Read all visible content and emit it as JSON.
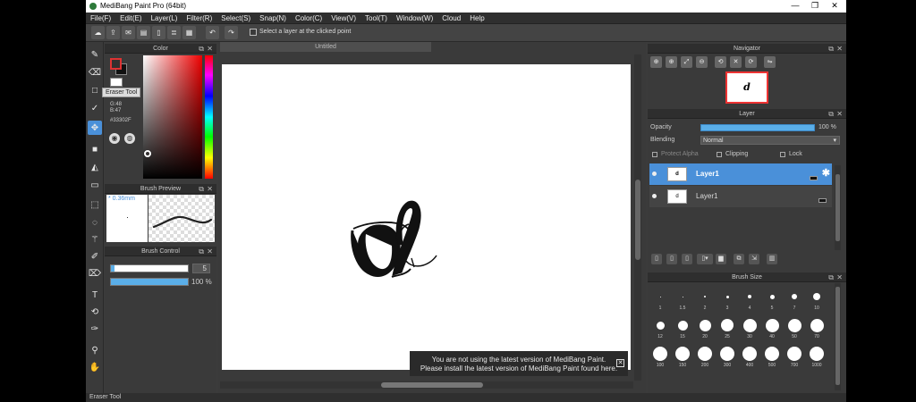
{
  "title": "MediBang Paint Pro (64bit)",
  "window_controls": [
    "—",
    "❐",
    "✕"
  ],
  "menu": [
    "File(F)",
    "Edit(E)",
    "Layer(L)",
    "Filter(R)",
    "Select(S)",
    "Snap(N)",
    "Color(C)",
    "View(V)",
    "Tool(T)",
    "Window(W)",
    "Cloud",
    "Help"
  ],
  "toolbar": {
    "icons": [
      "cloud-icon",
      "share-icon",
      "comment-icon",
      "message-icon",
      "document-icon",
      "list-icon",
      "grid-icon",
      "undo-icon",
      "redo-icon"
    ],
    "select_layer_label": "Select a layer at the clicked point"
  },
  "tools": [
    "brush-tool",
    "eraser-tool",
    "rectangle-tool",
    "selection-brush-tool",
    "move-tool",
    "fill-rectangle-tool",
    "bucket-tool",
    "gradient-tool",
    "select-rect-tool",
    "lasso-tool",
    "magic-wand-tool",
    "select-pen-tool",
    "select-eraser-tool",
    "text-tool",
    "operation-tool",
    "eyedropper-tool",
    "dropper-tool",
    "hand-tool"
  ],
  "tooltip": "Eraser Tool",
  "color_panel": {
    "title": "Color",
    "g_label": "G:48",
    "b_label": "B:47",
    "hex": "#33302F",
    "fg_color": "#33302f"
  },
  "brush_preview": {
    "title": "Brush Preview",
    "size": "* 0.36mm"
  },
  "brush_control": {
    "title": "Brush Control",
    "size_value": "5",
    "size_fraction": 0.05,
    "opacity_value": "100 %",
    "opacity_fraction": 1.0
  },
  "canvas": {
    "doc_title": "Untitled",
    "letter": "d"
  },
  "notice": {
    "line1": "You are not using the latest version of MediBang Paint.",
    "line2": "Please install the latest version of MediBang Paint found here.",
    "close": "✕"
  },
  "navigator": {
    "title": "Navigator",
    "thumb": "d"
  },
  "layer_panel": {
    "title": "Layer",
    "opacity_label": "Opacity",
    "opacity_value": "100 %",
    "opacity_fraction": 1.0,
    "blending_label": "Blending",
    "blending_value": "Normal",
    "protect_alpha": "Protect Alpha",
    "clipping": "Clipping",
    "lock": "Lock",
    "layers": [
      {
        "name": "Layer1",
        "selected": true
      },
      {
        "name": "Layer1",
        "selected": false
      }
    ]
  },
  "brush_size": {
    "title": "Brush Size",
    "sizes": [
      "1",
      "1.5",
      "2",
      "3",
      "4",
      "5",
      "7",
      "10",
      "12",
      "15",
      "20",
      "25",
      "30",
      "40",
      "50",
      "70",
      "100",
      "150",
      "200",
      "300",
      "400",
      "500",
      "700",
      "1000"
    ]
  },
  "status": "Eraser Tool"
}
